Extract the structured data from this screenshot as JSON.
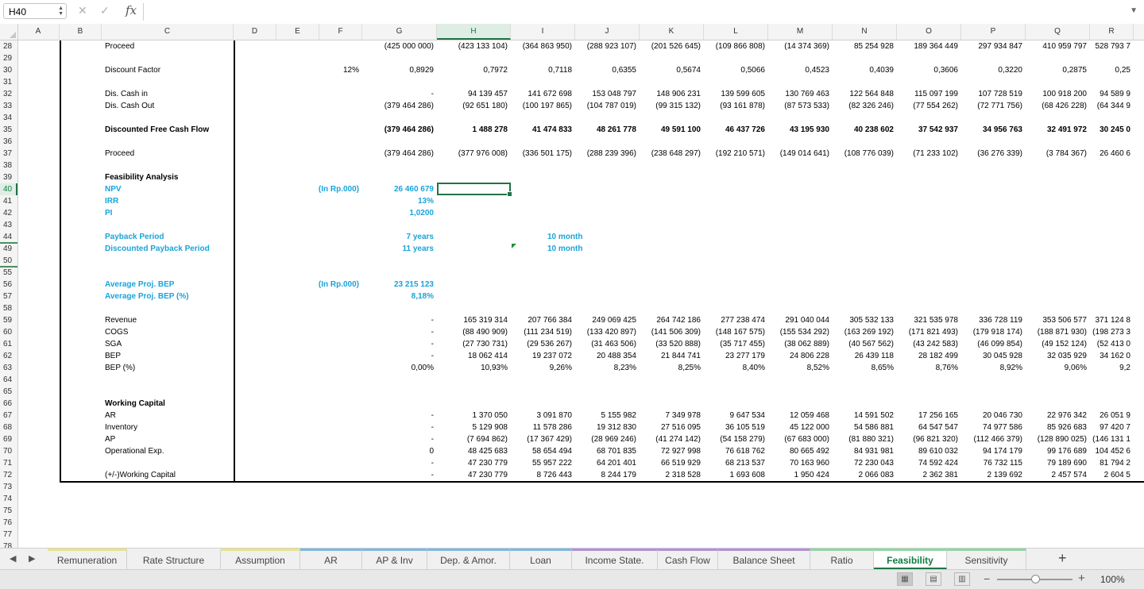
{
  "formula_bar": {
    "name_box": "H40",
    "cancel_icon": "✕",
    "enter_icon": "✓",
    "fx_label": "fx",
    "formula": ""
  },
  "columns": [
    {
      "letter": "A",
      "w": 53
    },
    {
      "letter": "B",
      "w": 53
    },
    {
      "letter": "C",
      "w": 166
    },
    {
      "letter": "D",
      "w": 54
    },
    {
      "letter": "E",
      "w": 54
    },
    {
      "letter": "F",
      "w": 54
    },
    {
      "letter": "G",
      "w": 94
    },
    {
      "letter": "H",
      "w": 93
    },
    {
      "letter": "I",
      "w": 81
    },
    {
      "letter": "J",
      "w": 81
    },
    {
      "letter": "K",
      "w": 81
    },
    {
      "letter": "L",
      "w": 81
    },
    {
      "letter": "M",
      "w": 81
    },
    {
      "letter": "N",
      "w": 81
    },
    {
      "letter": "O",
      "w": 81
    },
    {
      "letter": "P",
      "w": 81
    },
    {
      "letter": "Q",
      "w": 81
    },
    {
      "letter": "R",
      "w": 55
    }
  ],
  "selected_column": "H",
  "selected_row": "40",
  "rows": [
    "28",
    "29",
    "30",
    "31",
    "32",
    "33",
    "34",
    "35",
    "36",
    "37",
    "38",
    "39",
    "40",
    "41",
    "42",
    "43",
    "44",
    "49",
    "50",
    "55",
    "56",
    "57",
    "58",
    "59",
    "60",
    "61",
    "62",
    "63",
    "64",
    "65",
    "66",
    "67",
    "68",
    "69",
    "70",
    "71",
    "72",
    "73",
    "74",
    "75",
    "76",
    "77",
    "78"
  ],
  "hidden_after_rows": [
    "44",
    "50"
  ],
  "cells": {
    "28": {
      "C": "Proceed",
      "G": "(425 000 000)",
      "H": "(423 133 104)",
      "I": "(364 863 950)",
      "J": "(288 923 107)",
      "K": "(201 526 645)",
      "L": "(109 866 808)",
      "M": "(14 374 369)",
      "N": "85 254 928",
      "O": "189 364 449",
      "P": "297 934 847",
      "Q": "410 959 797",
      "R": "528 793 7"
    },
    "30": {
      "C": "Discount Factor",
      "F": "12%",
      "G": "0,8929",
      "H": "0,7972",
      "I": "0,7118",
      "J": "0,6355",
      "K": "0,5674",
      "L": "0,5066",
      "M": "0,4523",
      "N": "0,4039",
      "O": "0,3606",
      "P": "0,3220",
      "Q": "0,2875",
      "R": "0,25"
    },
    "32": {
      "C": "Dis. Cash in",
      "G": "-",
      "H": "94 139 457",
      "I": "141 672 698",
      "J": "153 048 797",
      "K": "148 906 231",
      "L": "139 599 605",
      "M": "130 769 463",
      "N": "122 564 848",
      "O": "115 097 199",
      "P": "107 728 519",
      "Q": "100 918 200",
      "R": "94 589 9"
    },
    "33": {
      "C": "Dis. Cash Out",
      "G": "(379 464 286)",
      "H": "(92 651 180)",
      "I": "(100 197 865)",
      "J": "(104 787 019)",
      "K": "(99 315 132)",
      "L": "(93 161 878)",
      "M": "(87 573 533)",
      "N": "(82 326 246)",
      "O": "(77 554 262)",
      "P": "(72 771 756)",
      "Q": "(68 426 228)",
      "R": "(64 344 9"
    },
    "35": {
      "C": "Discounted Free Cash Flow",
      "G": "(379 464 286)",
      "H": "1 488 278",
      "I": "41 474 833",
      "J": "48 261 778",
      "K": "49 591 100",
      "L": "46 437 726",
      "M": "43 195 930",
      "N": "40 238 602",
      "O": "37 542 937",
      "P": "34 956 763",
      "Q": "32 491 972",
      "R": "30 245 0"
    },
    "37": {
      "C": "Proceed",
      "G": "(379 464 286)",
      "H": "(377 976 008)",
      "I": "(336 501 175)",
      "J": "(288 239 396)",
      "K": "(238 648 297)",
      "L": "(192 210 571)",
      "M": "(149 014 641)",
      "N": "(108 776 039)",
      "O": "(71 233 102)",
      "P": "(36 276 339)",
      "Q": "(3 784 367)",
      "R": "26 460 6"
    },
    "39": {
      "C": "Feasibility Analysis"
    },
    "40": {
      "C": "NPV",
      "F": "(In Rp.000)",
      "G": "26 460 679"
    },
    "41": {
      "C": "IRR",
      "G": "13%"
    },
    "42": {
      "C": "PI",
      "G": "1,0200"
    },
    "44": {
      "C": "Payback Period",
      "G": "7  years",
      "I": "10  month"
    },
    "49": {
      "C": "Discounted Payback Period",
      "G": "11  years",
      "I": "10  month"
    },
    "56": {
      "C": "Average Proj. BEP",
      "F": "(In Rp.000)",
      "G": "23 215 123"
    },
    "57": {
      "C": "Average Proj. BEP (%)",
      "G": "8,18%"
    },
    "59": {
      "C": "Revenue",
      "G": "-",
      "H": "165 319 314",
      "I": "207 766 384",
      "J": "249 069 425",
      "K": "264 742 186",
      "L": "277 238 474",
      "M": "291 040 044",
      "N": "305 532 133",
      "O": "321 535 978",
      "P": "336 728 119",
      "Q": "353 506 577",
      "R": "371 124 8"
    },
    "60": {
      "C": "COGS",
      "G": "-",
      "H": "(88 490 909)",
      "I": "(111 234 519)",
      "J": "(133 420 897)",
      "K": "(141 506 309)",
      "L": "(148 167 575)",
      "M": "(155 534 292)",
      "N": "(163 269 192)",
      "O": "(171 821 493)",
      "P": "(179 918 174)",
      "Q": "(188 871 930)",
      "R": "(198 273 3"
    },
    "61": {
      "C": "SGA",
      "G": "-",
      "H": "(27 730 731)",
      "I": "(29 536 267)",
      "J": "(31 463 506)",
      "K": "(33 520 888)",
      "L": "(35 717 455)",
      "M": "(38 062 889)",
      "N": "(40 567 562)",
      "O": "(43 242 583)",
      "P": "(46 099 854)",
      "Q": "(49 152 124)",
      "R": "(52 413 0"
    },
    "62": {
      "C": "BEP",
      "G": "-",
      "H": "18 062 414",
      "I": "19 237 072",
      "J": "20 488 354",
      "K": "21 844 741",
      "L": "23 277 179",
      "M": "24 806 228",
      "N": "26 439 118",
      "O": "28 182 499",
      "P": "30 045 928",
      "Q": "32 035 929",
      "R": "34 162 0"
    },
    "63": {
      "C": "BEP (%)",
      "G": "0,00%",
      "H": "10,93%",
      "I": "9,26%",
      "J": "8,23%",
      "K": "8,25%",
      "L": "8,40%",
      "M": "8,52%",
      "N": "8,65%",
      "O": "8,76%",
      "P": "8,92%",
      "Q": "9,06%",
      "R": "9,2"
    },
    "66": {
      "C": "Working Capital"
    },
    "67": {
      "C": "AR",
      "G": "-",
      "H": "1 370 050",
      "I": "3 091 870",
      "J": "5 155 982",
      "K": "7 349 978",
      "L": "9 647 534",
      "M": "12 059 468",
      "N": "14 591 502",
      "O": "17 256 165",
      "P": "20 046 730",
      "Q": "22 976 342",
      "R": "26 051 9"
    },
    "68": {
      "C": "Inventory",
      "G": "-",
      "H": "5 129 908",
      "I": "11 578 286",
      "J": "19 312 830",
      "K": "27 516 095",
      "L": "36 105 519",
      "M": "45 122 000",
      "N": "54 586 881",
      "O": "64 547 547",
      "P": "74 977 586",
      "Q": "85 926 683",
      "R": "97 420 7"
    },
    "69": {
      "C": "AP",
      "G": "-",
      "H": "(7 694 862)",
      "I": "(17 367 429)",
      "J": "(28 969 246)",
      "K": "(41 274 142)",
      "L": "(54 158 279)",
      "M": "(67 683 000)",
      "N": "(81 880 321)",
      "O": "(96 821 320)",
      "P": "(112 466 379)",
      "Q": "(128 890 025)",
      "R": "(146 131 1"
    },
    "70": {
      "C": "Operational Exp.",
      "G": "0",
      "H": "48 425 683",
      "I": "58 654 494",
      "J": "68 701 835",
      "K": "72 927 998",
      "L": "76 618 762",
      "M": "80 665 492",
      "N": "84 931 981",
      "O": "89 610 032",
      "P": "94 174 179",
      "Q": "99 176 689",
      "R": "104 452 6"
    },
    "71": {
      "G": "-",
      "H": "47 230 779",
      "I": "55 957 222",
      "J": "64 201 401",
      "K": "66 519 929",
      "L": "68 213 537",
      "M": "70 163 960",
      "N": "72 230 043",
      "O": "74 592 424",
      "P": "76 732 115",
      "Q": "79 189 690",
      "R": "81 794 2"
    },
    "72": {
      "C": "(+/-)Working Capital",
      "G": "-",
      "H": "47 230 779",
      "I": "8 726 443",
      "J": "8 244 179",
      "K": "2 318 528",
      "L": "1 693 608",
      "M": "1 950 424",
      "N": "2 066 083",
      "O": "2 362 381",
      "P": "2 139 692",
      "Q": "2 457 574",
      "R": "2 604 5"
    }
  },
  "bold_rows": [
    "35",
    "39"
  ],
  "blue_rows": [
    "40",
    "41",
    "42",
    "44",
    "49",
    "56",
    "57"
  ],
  "colors": {
    "accent": "#217346",
    "blue_text": "#1aa3d9"
  },
  "tabs": [
    {
      "label": "Remuneration",
      "color": "#e8e48a"
    },
    {
      "label": "Rate Structure",
      "color": ""
    },
    {
      "label": "Assumption",
      "color": "#e8e48a"
    },
    {
      "label": "AR",
      "color": "#7fb7e2"
    },
    {
      "label": "AP & Inv",
      "color": "#7fb7e2"
    },
    {
      "label": "Dep. & Amor.",
      "color": "#7fb7e2"
    },
    {
      "label": "Loan",
      "color": "#7fb7e2"
    },
    {
      "label": "Income State.",
      "color": "#b48fd6"
    },
    {
      "label": "Cash Flow",
      "color": "#b48fd6"
    },
    {
      "label": "Balance Sheet",
      "color": "#b48fd6"
    },
    {
      "label": "Ratio",
      "color": "#8fd6a4"
    },
    {
      "label": "Feasibility",
      "color": "#8fd6a4",
      "active": true
    },
    {
      "label": "Sensitivity",
      "color": "#8fd6a4"
    }
  ],
  "add_sheet": "+",
  "status": {
    "zoom": "100%",
    "zoom_level": 0.5,
    "zoom_minus": "−",
    "zoom_plus": "+"
  }
}
